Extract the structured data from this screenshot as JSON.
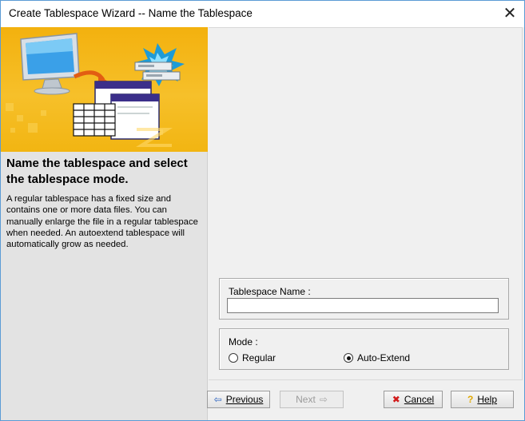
{
  "window": {
    "title": "Create Tablespace Wizard -- Name the Tablespace",
    "close_glyph": "✕"
  },
  "sidebar": {
    "heading": "Name the tablespace and select the tablespace mode.",
    "description": "A regular tablespace has a fixed size and contains one or more data files. You can manually enlarge the file in a regular tablespace when needed. An autoextend tablespace will automatically grow as needed.",
    "banner_icon": "database-wizard-illustration"
  },
  "form": {
    "tablespace_name_label": "Tablespace Name :",
    "tablespace_name_value": "",
    "mode_label": "Mode :",
    "mode_options": [
      {
        "label": "Regular",
        "selected": false
      },
      {
        "label": "Auto-Extend",
        "selected": true
      }
    ]
  },
  "buttons": {
    "previous": {
      "label": "Previous",
      "icon": "arrow-left-icon",
      "enabled": true
    },
    "next": {
      "label": "Next",
      "icon": "arrow-right-icon",
      "enabled": false
    },
    "cancel": {
      "label": "Cancel",
      "icon": "red-x-icon",
      "enabled": true
    },
    "help": {
      "label": "Help",
      "icon": "question-mark-icon",
      "enabled": true
    }
  },
  "colors": {
    "banner": "#f3b10e",
    "accent_border": "#5b9bd5",
    "cancel_icon": "#d11b1b",
    "previous_icon": "#2b63c0"
  }
}
